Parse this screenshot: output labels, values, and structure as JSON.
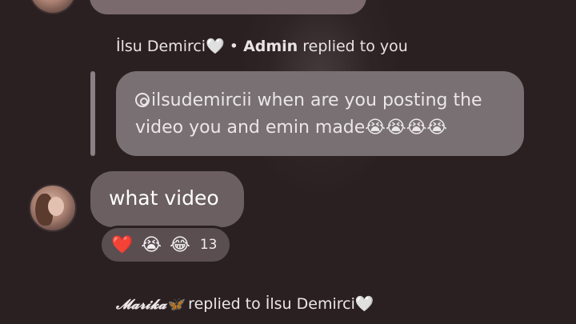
{
  "thread": {
    "reply_header": {
      "sender": "İlsu Demirci🤍",
      "separator": "•",
      "role": "Admin",
      "action": "replied to you"
    },
    "quoted_message": {
      "text": "ilsudemircii when are you posting the video you and emin made😭😭😭😭"
    },
    "message": {
      "text": "what video"
    },
    "reactions": {
      "emojis": [
        "❤️",
        "😭",
        "😂"
      ],
      "count": "13"
    },
    "footer": {
      "sender": "𝓜𝓪𝓻𝓲𝓴𝓪🦋",
      "action": "replied to İlsu Demirci🤍"
    }
  }
}
